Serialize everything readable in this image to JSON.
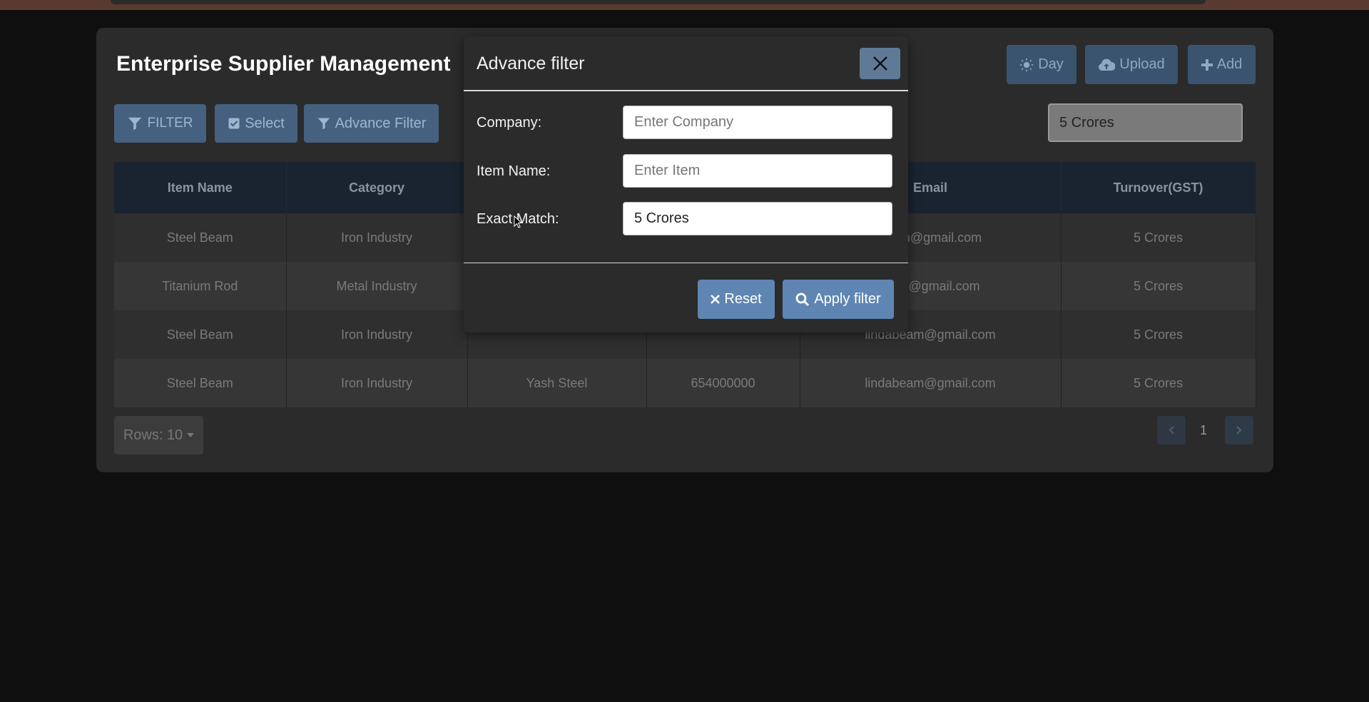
{
  "app": {
    "title": "Enterprise Supplier Management"
  },
  "toolbar": {
    "filter_label": "FILTER",
    "select_label": "Select",
    "advance_filter_label": "Advance Filter",
    "day_label": "Day",
    "upload_label": "Upload",
    "add_label": "Add",
    "search_value": "5 Crores"
  },
  "table": {
    "columns": [
      "Item Name",
      "Category",
      "",
      "",
      "Email",
      "Turnover(GST)"
    ],
    "rows": [
      [
        "Steel Beam",
        "Iron Industry",
        "",
        "",
        "am@gmail.com",
        "5 Crores"
      ],
      [
        "Titanium Rod",
        "Metal Industry",
        "",
        "",
        "an@gmail.com",
        "5 Crores"
      ],
      [
        "Steel Beam",
        "Iron Industry",
        "",
        "",
        "lindabeam@gmail.com",
        "5 Crores"
      ],
      [
        "Steel Beam",
        "Iron Industry",
        "Yash Steel",
        "654000000",
        "lindabeam@gmail.com",
        "5 Crores"
      ]
    ]
  },
  "footer": {
    "rows_label": "Rows: 10",
    "current_page": "1"
  },
  "modal": {
    "title": "Advance filter",
    "company_label": "Company:",
    "company_placeholder": "Enter Company",
    "company_value": "",
    "item_label": "Item Name:",
    "item_placeholder": "Enter Item",
    "item_value": "",
    "exact_label": "Exact Match:",
    "exact_value": "5 Crores",
    "reset_label": "Reset",
    "apply_label": "Apply filter"
  },
  "colors": {
    "background": "#0f0f0f",
    "card": "#2b2b2b",
    "primary_button": "#5f86b3",
    "table_header": "#1a2430"
  }
}
